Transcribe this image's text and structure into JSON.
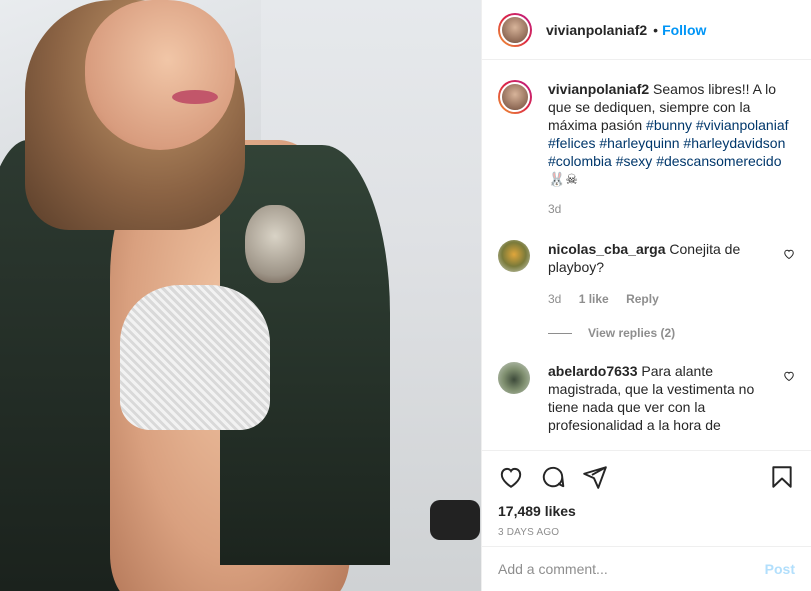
{
  "post": {
    "username": "vivianpolaniaf2",
    "follow_label": "Follow",
    "dot": "•"
  },
  "caption": {
    "username": "vivianpolaniaf2",
    "text": "Seamos libres!! A lo que se dediquen, siempre con la máxima pasión",
    "tags": [
      "#bunny",
      "#vivianpolaniaf",
      "#felices",
      "#harleyquinn",
      "#harleydavidson",
      "#colombia",
      "#sexy",
      "#descansomerecido"
    ],
    "emoji": "🐰☠",
    "time": "3d"
  },
  "comments": [
    {
      "username": "nicolas_cba_arga",
      "text": "Conejita de playboy?",
      "time": "3d",
      "likes": "1 like",
      "reply_label": "Reply",
      "view_replies": "View replies (2)"
    },
    {
      "username": "abelardo7633",
      "text": "Para alante magistrada, que la vestimenta no tiene nada que ver con la profesionalidad a la hora de"
    }
  ],
  "stats": {
    "likes": "17,489 likes",
    "date": "3 DAYS AGO"
  },
  "add_comment": {
    "placeholder": "Add a comment...",
    "post_label": "Post"
  },
  "icons": {
    "like": "heart-icon",
    "comment": "comment-icon",
    "share": "share-icon",
    "save": "bookmark-icon"
  },
  "colors": {
    "link": "#0095f6",
    "hashtag": "#00376b",
    "muted": "#8e8e8e",
    "post_disabled": "#b2dffc"
  }
}
